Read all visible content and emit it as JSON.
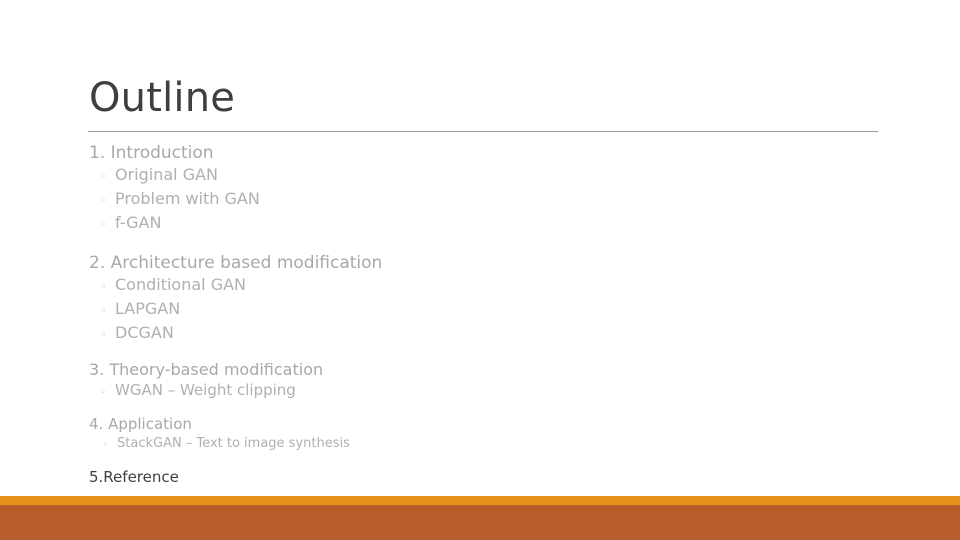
{
  "slide": {
    "title": "Outline",
    "background_color": "#ffffff",
    "title_color": "#3f3f3f",
    "rule_color": "#9d9d9d",
    "heading_color": "#a8a8a8",
    "sub_color": "#b0b0b0",
    "bullet_glyph": "◦",
    "bullet_color": "#cdbb8c",
    "footer_accent_color": "#e8921b",
    "footer_band_color": "#b85c2b"
  },
  "outline": [
    {
      "heading": "1. Introduction",
      "items": [
        "Original GAN",
        "Problem with GAN",
        "f-GAN"
      ]
    },
    {
      "heading": "2. Architecture based modification",
      "items": [
        "Conditional GAN",
        "LAPGAN",
        "DCGAN"
      ]
    },
    {
      "heading": "3. Theory-based modification",
      "items": [
        "WGAN – Weight clipping"
      ]
    },
    {
      "heading": "4. Application",
      "items": [
        "StackGAN – Text to image synthesis"
      ]
    },
    {
      "heading": "5.Reference",
      "items": []
    }
  ]
}
